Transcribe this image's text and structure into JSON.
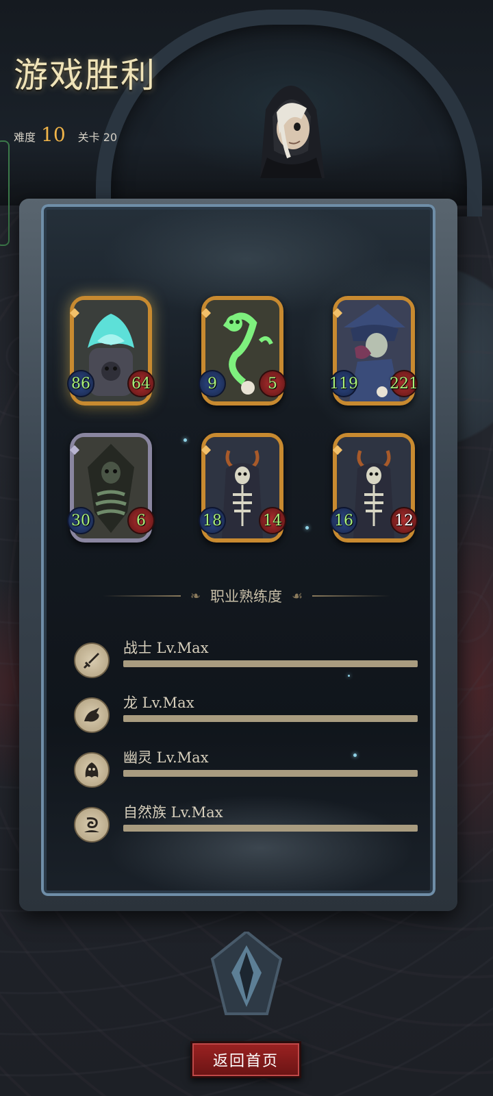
{
  "header": {
    "title": "游戏胜利",
    "difficulty_label": "难度",
    "difficulty_value": "10",
    "stage_label": "关卡 20"
  },
  "cards": [
    {
      "name": "ghost-flame-golem",
      "attack": "86",
      "health": "64",
      "frame": "gold",
      "highlight": true
    },
    {
      "name": "green-spirit-serpent",
      "attack": "9",
      "health": "5",
      "frame": "gold",
      "highlight": false
    },
    {
      "name": "hooded-witch",
      "attack": "119",
      "health": "221",
      "frame": "gold",
      "highlight": false
    },
    {
      "name": "shadow-skeleton",
      "attack": "30",
      "health": "6",
      "frame": "silver",
      "highlight": false
    },
    {
      "name": "lich-skeleton",
      "attack": "18",
      "health": "14",
      "frame": "gold",
      "highlight": false
    },
    {
      "name": "lich-skeleton",
      "attack": "16",
      "health": "12",
      "frame": "gold",
      "highlight": false
    }
  ],
  "mastery": {
    "title": "职业熟练度",
    "items": [
      {
        "label": "战士 Lv.Max",
        "icon": "sword-icon",
        "progress": 1.0
      },
      {
        "label": "龙 Lv.Max",
        "icon": "dragon-icon",
        "progress": 1.0
      },
      {
        "label": "幽灵 Lv.Max",
        "icon": "ghost-icon",
        "progress": 1.0
      },
      {
        "label": "自然族 Lv.Max",
        "icon": "nature-icon",
        "progress": 1.0
      }
    ]
  },
  "buttons": {
    "home_label": "返回首页"
  },
  "colors": {
    "gold_frame": "#c88a30",
    "silver_frame": "#8a86a0",
    "attack_text": "#a9f07a",
    "button": "#9c2222"
  }
}
